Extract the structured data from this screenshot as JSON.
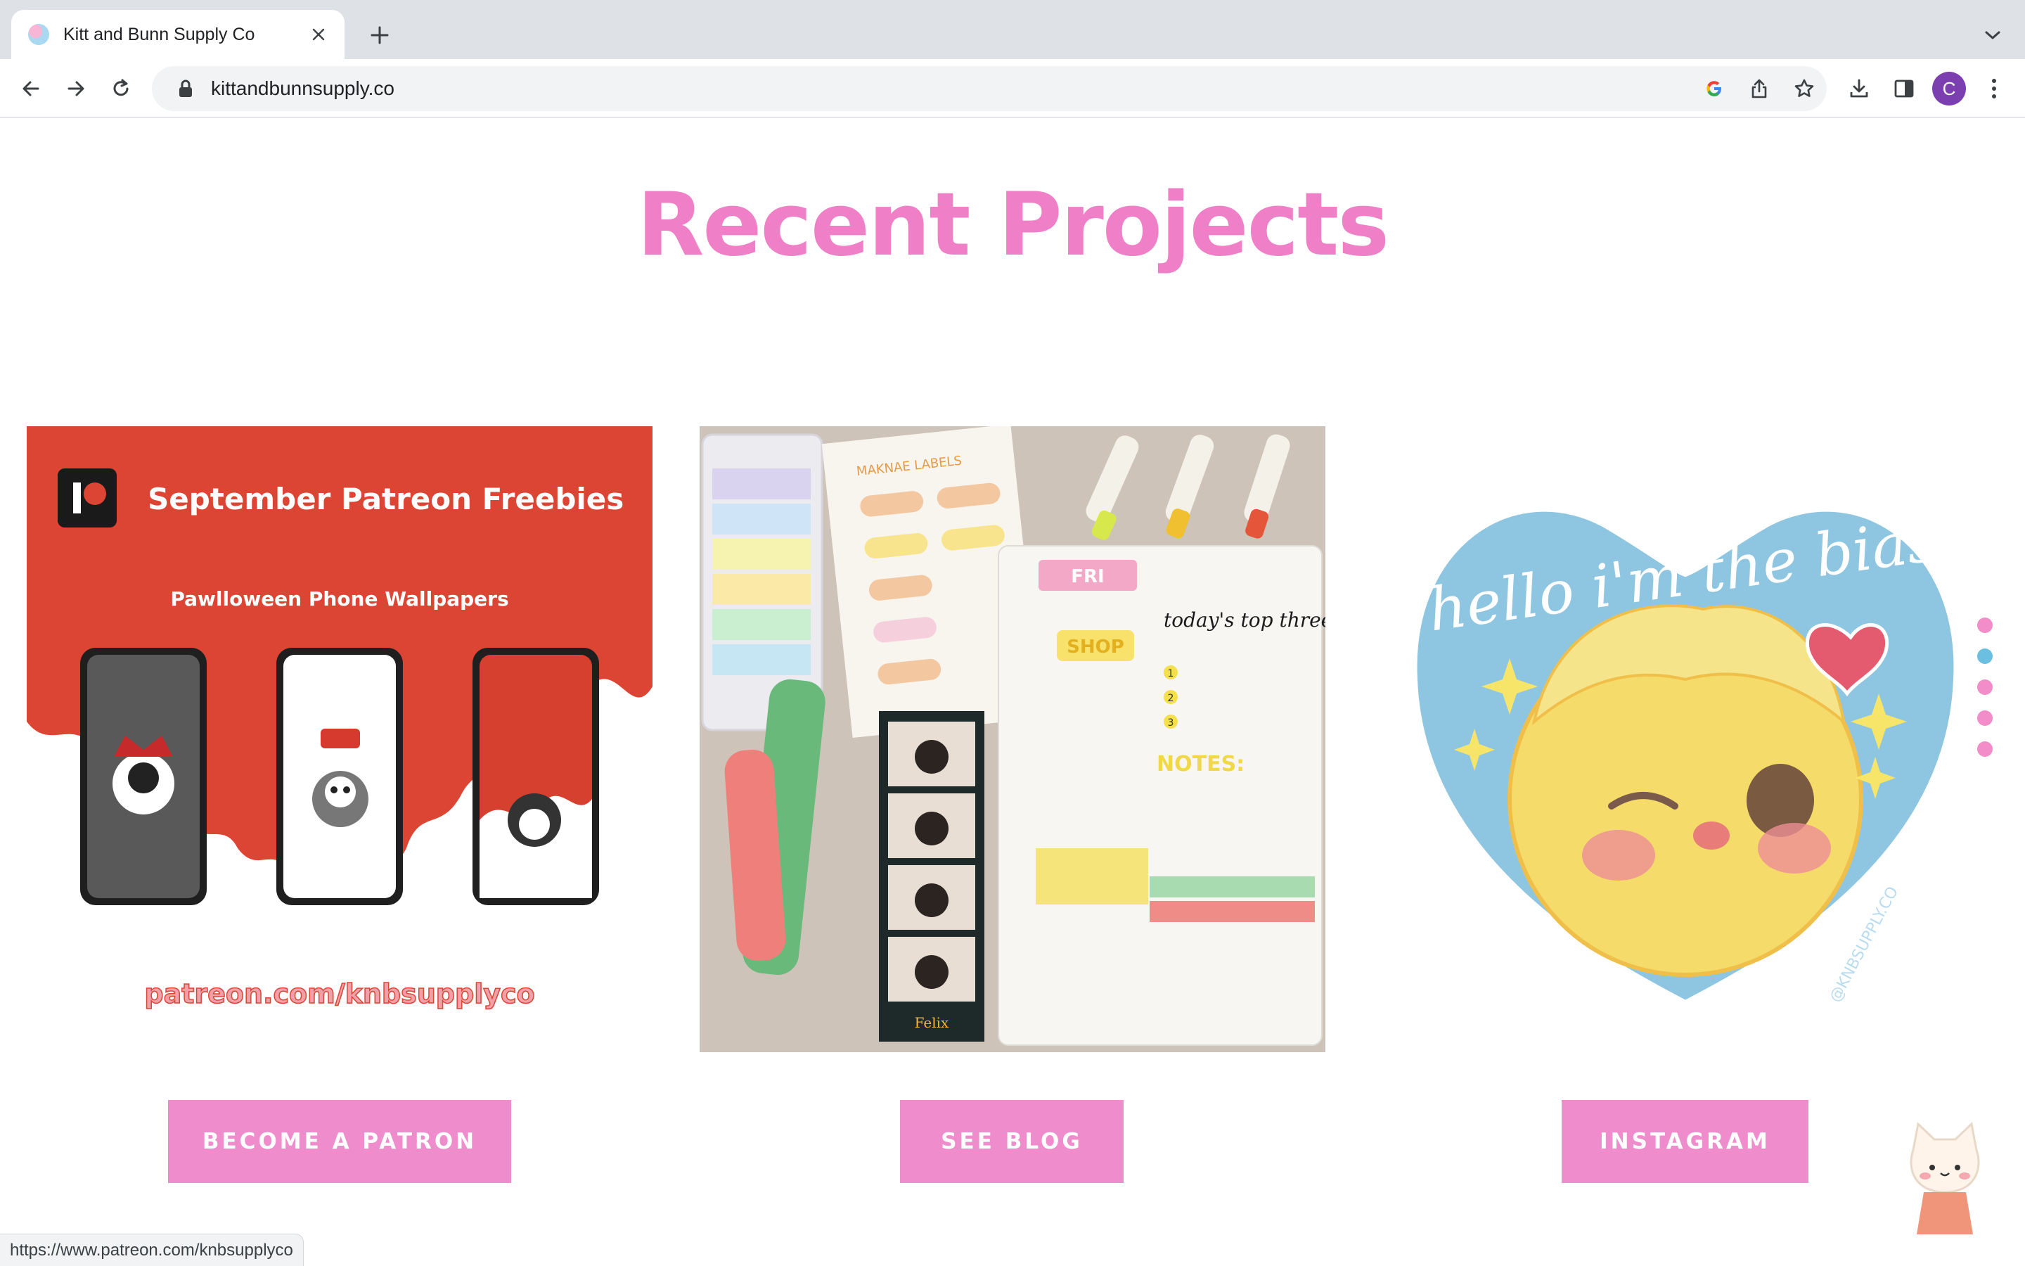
{
  "browser": {
    "tab_title": "Kitt and Bunn Supply Co",
    "url": "kittandbunnsupply.co",
    "profile_initial": "C",
    "status_url": "https://www.patreon.com/knbsupplyco"
  },
  "page": {
    "heading": "Recent Projects",
    "accent_color": "#ef7fc6",
    "button_color": "#ef8ccc",
    "cards": [
      {
        "banner_title": "September Patreon Freebies",
        "banner_subtitle": "Pawlloween Phone Wallpapers",
        "banner_link": "patreon.com/knbsupplyco",
        "button_label": "BECOME A PATRON"
      },
      {
        "photo_texts": [
          "MAKNAE LABELS",
          "FRI",
          "SHOP",
          "today's top three",
          "1",
          "2",
          "3",
          "NOTES:",
          "Felix"
        ],
        "button_label": "SEE BLOG"
      },
      {
        "sticker_text": "hello i'm the bias",
        "sticker_handle": "@KNBSUPPLY.CO",
        "button_label": "INSTAGRAM"
      }
    ],
    "carousel_dots": 5,
    "active_dot": 1
  }
}
